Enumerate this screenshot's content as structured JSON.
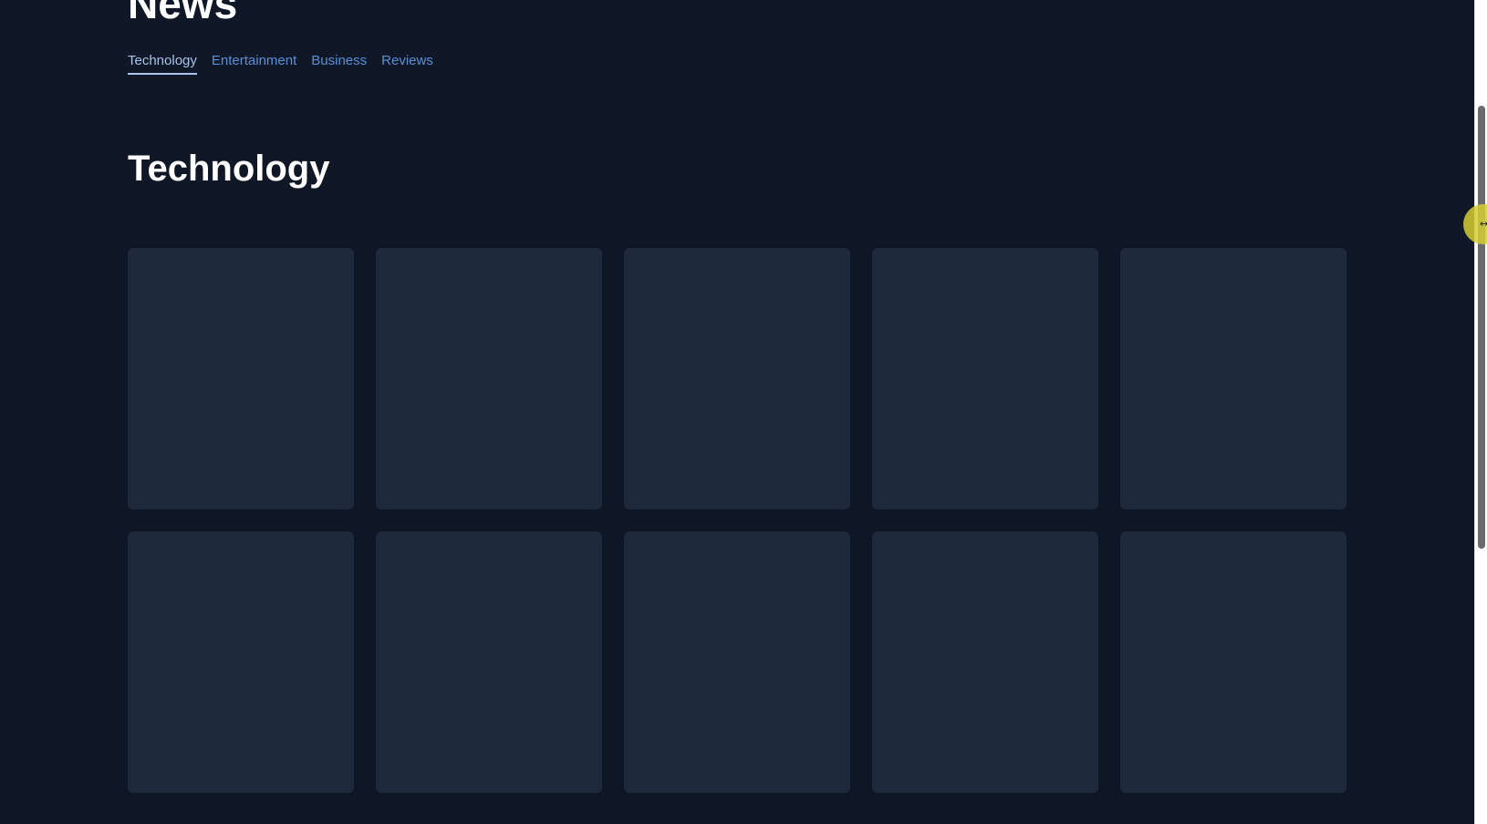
{
  "header": {
    "site_title": "News"
  },
  "nav": {
    "tabs": [
      {
        "label": "Technology",
        "active": true
      },
      {
        "label": "Entertainment",
        "active": false
      },
      {
        "label": "Business",
        "active": false
      },
      {
        "label": "Reviews",
        "active": false
      }
    ]
  },
  "main": {
    "section_title": "Technology",
    "card_count": 10,
    "cards_loading": true
  },
  "colors": {
    "background": "#101827",
    "card": "#1e293b",
    "tab_link": "#5a8fd6",
    "tab_active": "#a9c4ea",
    "heading": "#ffffff",
    "cursor_highlight": "#d6ce34"
  },
  "icons": {
    "cursor": "resize-horizontal-icon"
  }
}
